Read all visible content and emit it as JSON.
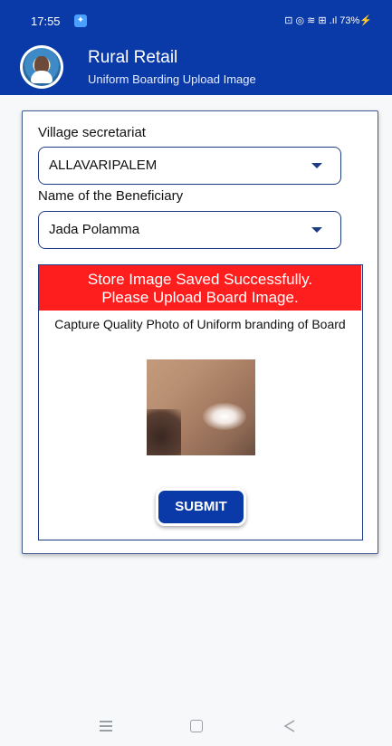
{
  "status_bar": {
    "time": "17:55",
    "indicators": "⊡ ◎ ≋ ⊞ .ıl 73%⚡"
  },
  "header": {
    "title": "Rural Retail",
    "subtitle": "Uniform Boarding Upload Image"
  },
  "form": {
    "village_label": "Village secretariat",
    "village_value": "ALLAVARIPALEM",
    "beneficiary_label": "Name of the Beneficiary",
    "beneficiary_value": "Jada Polamma"
  },
  "upload": {
    "banner_line1": "Store Image Saved Successfully.",
    "banner_line2": "Please Upload Board Image.",
    "instruction": "Capture Quality Photo of Uniform branding of Board",
    "submit_label": "SUBMIT"
  },
  "colors": {
    "primary": "#0a3aa8",
    "banner": "#ff1e1e",
    "border": "#1e3c86"
  },
  "icons": {
    "dropdown": "chevron-down-icon",
    "nav_menu": "menu-icon",
    "nav_home": "home-icon",
    "nav_back": "back-icon"
  }
}
